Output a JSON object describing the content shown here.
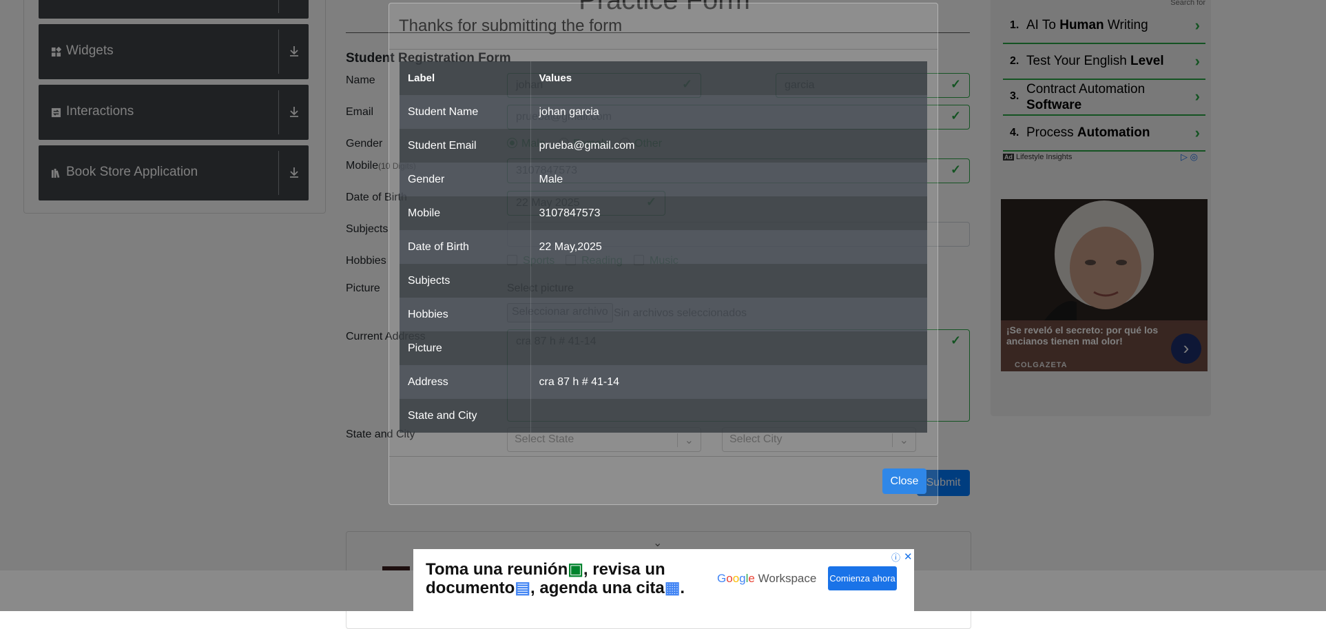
{
  "sidebar": {
    "items": [
      {
        "label": "Widgets",
        "icon": "widgets-icon"
      },
      {
        "label": "Interactions",
        "icon": "interactions-icon"
      },
      {
        "label": "Book Store Application",
        "icon": "book-store-icon"
      }
    ]
  },
  "form": {
    "page_title": "Practice Form",
    "subtitle": "Student Registration Form",
    "labels": {
      "name": "Name",
      "email": "Email",
      "gender": "Gender",
      "mobile": "Mobile",
      "mobile_hint": "(10 Digits)",
      "dob": "Date of Birth",
      "subjects": "Subjects",
      "hobbies": "Hobbies",
      "picture": "Picture",
      "address": "Current Address",
      "state_city": "State and City"
    },
    "first_name": "johan",
    "last_name": "garcia",
    "email": "prueba@gmail.com",
    "gender_options": [
      "Male",
      "Female",
      "Other"
    ],
    "mobile": "3107847573",
    "dob": "22 May 2025",
    "hobbies": [
      "Sports",
      "Reading",
      "Music"
    ],
    "picture_label": "Select picture",
    "file_button": "Seleccionar archivo",
    "file_status": "Sin archivos seleccionados",
    "address": "cra 87 h # 41-14",
    "state_placeholder": "Select State",
    "city_placeholder": "Select City",
    "submit_label": "Submit"
  },
  "right_ads": {
    "search_label": "Search for",
    "links": [
      {
        "num": "1.",
        "text": "AI To ",
        "bold": "Human",
        "text2": " Writing"
      },
      {
        "num": "2.",
        "text": "Test Your English ",
        "bold": "Level",
        "text2": ""
      },
      {
        "num": "3.",
        "text": "Contract Automation",
        "bold": "Software",
        "text2": ""
      },
      {
        "num": "4.",
        "text": "Process ",
        "bold": "Automation",
        "text2": ""
      }
    ],
    "ad_badge": "Ad",
    "ad_source": "Lifestyle Insights",
    "photo_caption": "¡Se reveló el secreto: por qué los ancianos tienen mal olor!",
    "photo_brand": "COLGAZETA"
  },
  "modal": {
    "title": "Thanks for submitting the form",
    "headers": [
      "Label",
      "Values"
    ],
    "rows": [
      {
        "label": "Student Name",
        "value": "johan garcia"
      },
      {
        "label": "Student Email",
        "value": "prueba@gmail.com"
      },
      {
        "label": "Gender",
        "value": "Male"
      },
      {
        "label": "Mobile",
        "value": "3107847573"
      },
      {
        "label": "Date of Birth",
        "value": "22 May,2025"
      },
      {
        "label": "Subjects",
        "value": ""
      },
      {
        "label": "Hobbies",
        "value": ""
      },
      {
        "label": "Picture",
        "value": ""
      },
      {
        "label": "Address",
        "value": "cra 87 h # 41-14"
      },
      {
        "label": "State and City",
        "value": ""
      }
    ],
    "close_label": "Close"
  },
  "banner": {
    "text_line1": "Toma una reunión",
    "text_line1b": ", revisa un",
    "text_line2": "documento",
    "text_line2b": ", agenda una cita",
    "text_line2c": ".",
    "brand": "Workspace",
    "cta": "Comienza ahora"
  },
  "colors": {
    "accent": "#007bff",
    "success": "#28a745",
    "sidebar_bg": "#3e4247"
  }
}
